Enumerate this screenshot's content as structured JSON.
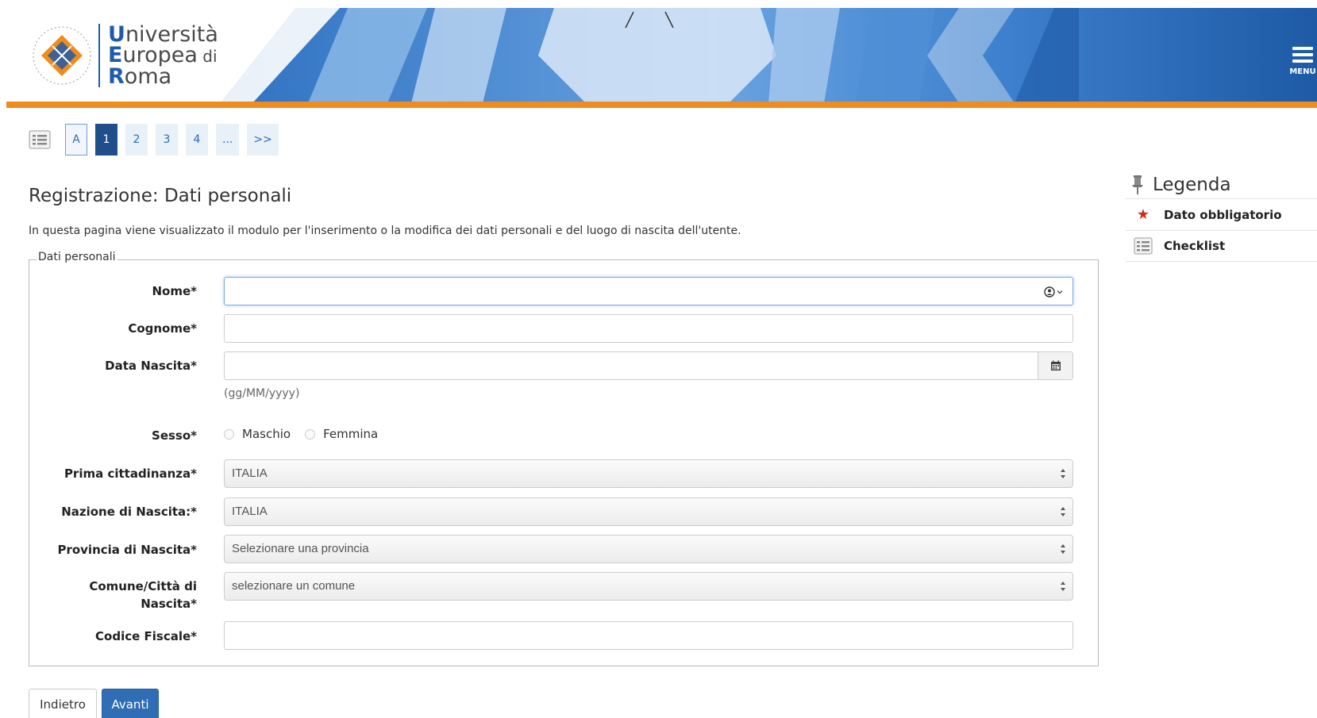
{
  "header": {
    "logo_line1_cap": "U",
    "logo_line1_rest": "niversità",
    "logo_line2_cap": "E",
    "logo_line2_rest": "uropea",
    "logo_line2_di": " di",
    "logo_line3_cap": "R",
    "logo_line3_rest": "oma",
    "menu_label": "MENU",
    "colors": {
      "banner": "#1f5ba8",
      "accent": "#f08c1e"
    }
  },
  "pager": {
    "list_icon": "list-icon",
    "items": [
      {
        "label": "A",
        "state": "outlined"
      },
      {
        "label": "1",
        "state": "active"
      },
      {
        "label": "2",
        "state": "normal"
      },
      {
        "label": "3",
        "state": "normal"
      },
      {
        "label": "4",
        "state": "normal"
      },
      {
        "label": "...",
        "state": "normal"
      },
      {
        "label": ">>",
        "state": "normal"
      }
    ]
  },
  "page": {
    "title": "Registrazione: Dati personali",
    "description": "In questa pagina viene visualizzato il modulo per l'inserimento o la modifica dei dati personali e del luogo di nascita dell'utente."
  },
  "form": {
    "legend": "Dati personali",
    "nome_label": "Nome*",
    "nome_value": "",
    "cognome_label": "Cognome*",
    "cognome_value": "",
    "data_label": "Data Nascita*",
    "data_value": "",
    "data_hint": "(gg/MM/yyyy)",
    "sesso_label": "Sesso*",
    "sesso_options": [
      "Maschio",
      "Femmina"
    ],
    "cittadinanza_label": "Prima cittadinanza*",
    "cittadinanza_value": "ITALIA",
    "nazione_label": "Nazione di Nascita:*",
    "nazione_value": "ITALIA",
    "provincia_label": "Provincia di Nascita*",
    "provincia_value": "Selezionare una provincia",
    "comune_label_line1": "Comune/Città di",
    "comune_label_line2": "Nascita*",
    "comune_value": "selezionare un comune",
    "codice_label": "Codice Fiscale*",
    "codice_value": ""
  },
  "buttons": {
    "back": "Indietro",
    "next": "Avanti"
  },
  "legenda": {
    "title": "Legenda",
    "items": [
      {
        "icon": "star-icon",
        "label": "Dato obbligatorio"
      },
      {
        "icon": "checklist-icon",
        "label": "Checklist"
      }
    ]
  }
}
